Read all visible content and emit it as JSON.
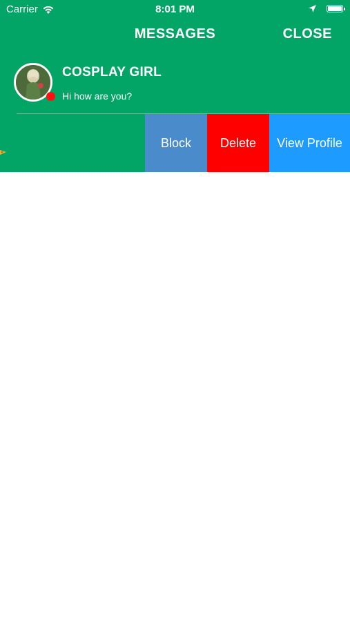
{
  "status_bar": {
    "carrier": "Carrier",
    "time": "8:01 PM",
    "icons": [
      "wifi-icon",
      "location-icon",
      "battery-icon"
    ]
  },
  "header": {
    "title": "MESSAGES",
    "close_label": "CLOSE"
  },
  "conversation": {
    "name": "COSPLAY GIRL",
    "last_message": "Hi how are you?",
    "online": true
  },
  "swipe_actions": {
    "block_label": "Block",
    "delete_label": "Delete",
    "view_profile_label": "View Profile"
  },
  "colors": {
    "header_green": "#02A566",
    "block_blue": "#4A8CCB",
    "delete_red": "#FF0000",
    "profile_blue": "#1E9BFF",
    "online_dot": "#FF1010"
  }
}
